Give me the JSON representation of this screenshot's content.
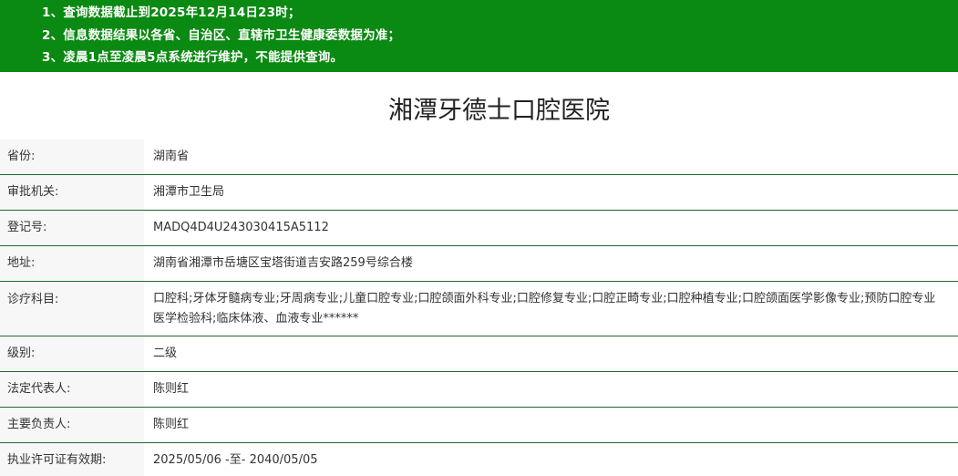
{
  "notice": {
    "lines": [
      "1、查询数据截止到2025年12月14日23时；",
      "2、信息数据结果以各省、自治区、直辖市卫生健康委数据为准；",
      "3、凌晨1点至凌晨5点系统进行维护，不能提供查询。"
    ]
  },
  "hospital": {
    "name": "湘潭牙德士口腔医院"
  },
  "fields": {
    "province": {
      "label": "省份:",
      "value": "湖南省"
    },
    "authority": {
      "label": "审批机关:",
      "value": "湘潭市卫生局"
    },
    "reg_no": {
      "label": "登记号:",
      "value": "MADQ4D4U243030415A5112"
    },
    "address": {
      "label": "地址:",
      "value": "湖南省湘潭市岳塘区宝塔街道吉安路259号综合楼"
    },
    "departments": {
      "label": "诊疗科目:",
      "value_line1": "口腔科;牙体牙髓病专业;牙周病专业;儿童口腔专业;口腔颌面外科专业;口腔修复专业;口腔正畸专业;口腔种植专业;口腔颌面医学影像专业;预防口腔专业",
      "value_line2": "医学检验科;临床体液、血液专业******"
    },
    "level": {
      "label": "级别:",
      "value": "二级"
    },
    "legal_rep": {
      "label": "法定代表人:",
      "value": "陈则红"
    },
    "principal": {
      "label": "主要负责人:",
      "value": "陈则红"
    },
    "license_validity": {
      "label": "执业许可证有效期:",
      "value": "2025/05/06 -至- 2040/05/05"
    }
  }
}
